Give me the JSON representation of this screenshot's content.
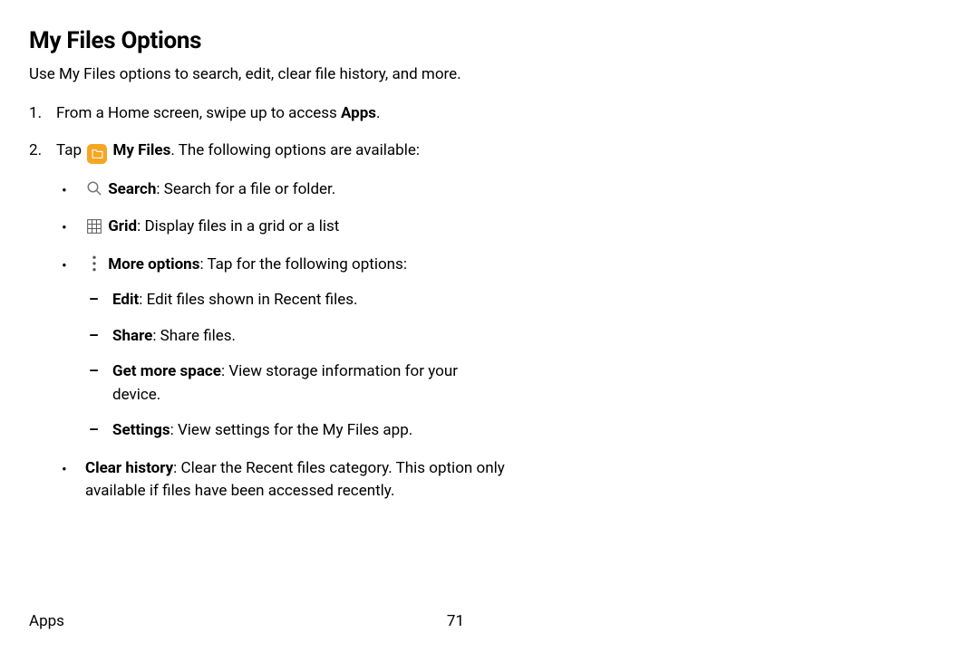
{
  "title": "My Files Options",
  "intro": "Use My Files options to search, edit, clear file history, and more.",
  "steps": {
    "s1_pre": "From a Home screen, swipe up to access ",
    "s1_bold": "Apps",
    "s1_post": ".",
    "s2_pre": "Tap ",
    "s2_app": "My Files",
    "s2_post": ". The following options are available:"
  },
  "bullets": {
    "search_label": "Search",
    "search_desc": ": Search for a file or folder.",
    "grid_label": "Grid",
    "grid_desc": ": Display files in a grid or a list",
    "more_label": "More options",
    "more_desc": ": Tap for the following options:",
    "clear_label": "Clear history",
    "clear_desc": ": Clear the Recent files category. This option only available if files have been accessed recently."
  },
  "more_items": {
    "edit_label": "Edit",
    "edit_desc": ": Edit files shown in Recent files.",
    "share_label": "Share",
    "share_desc": ": Share files.",
    "space_label": "Get more space",
    "space_desc": ": View storage information for your device.",
    "settings_label": "Settings",
    "settings_desc": ": View settings for the My Files app."
  },
  "footer": {
    "section": "Apps",
    "page": "71"
  }
}
